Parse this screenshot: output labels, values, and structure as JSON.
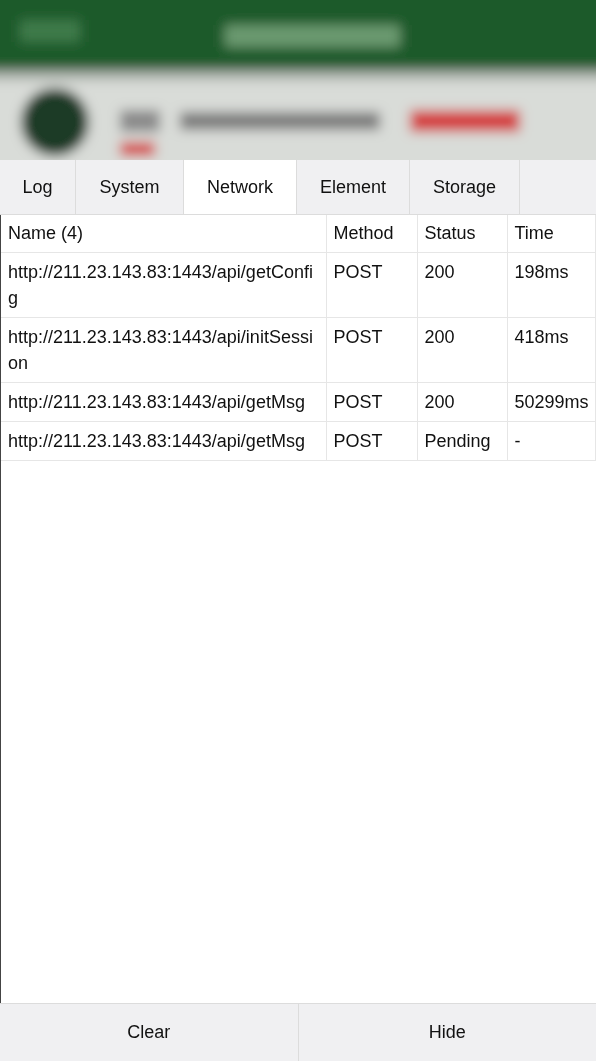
{
  "tabs": [
    {
      "label": "Log",
      "selected": false
    },
    {
      "label": "System",
      "selected": false
    },
    {
      "label": "Network",
      "selected": true
    },
    {
      "label": "Element",
      "selected": false
    },
    {
      "label": "Storage",
      "selected": false
    }
  ],
  "table": {
    "columns": [
      "Name (4)",
      "Method",
      "Status",
      "Time"
    ],
    "rows": [
      {
        "name": "http://211.23.143.83:1443/api/getConfig",
        "method": "POST",
        "status": "200",
        "time": "198ms"
      },
      {
        "name": "http://211.23.143.83:1443/api/initSession",
        "method": "POST",
        "status": "200",
        "time": "418ms"
      },
      {
        "name": "http://211.23.143.83:1443/api/getMsg",
        "method": "POST",
        "status": "200",
        "time": "50299ms"
      },
      {
        "name": "http://211.23.143.83:1443/api/getMsg",
        "method": "POST",
        "status": "Pending",
        "time": "-"
      }
    ]
  },
  "buttons": [
    "Clear",
    "Hide"
  ]
}
